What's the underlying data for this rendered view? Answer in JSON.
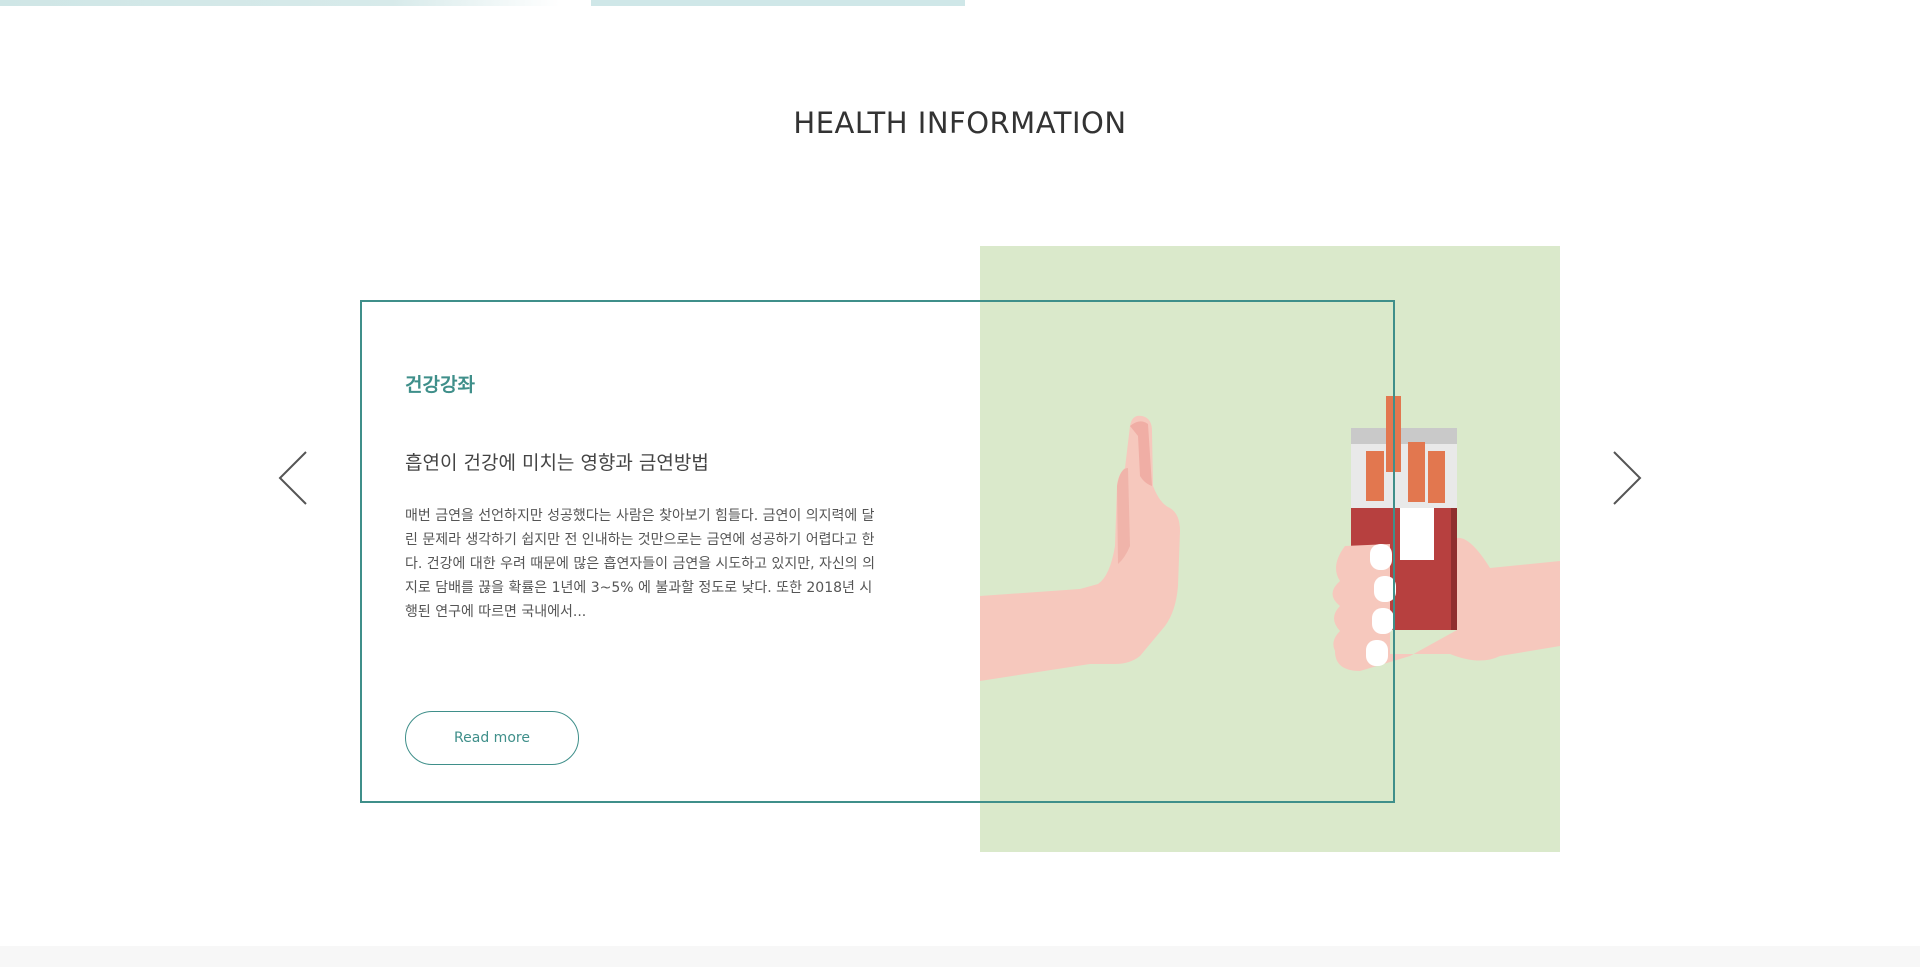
{
  "section": {
    "title": "HEALTH INFORMATION"
  },
  "card": {
    "category": "건강강좌",
    "headline": "흡연이 건강에 미치는 영향과 금연방법",
    "body": "매번 금연을 선언하지만 성공했다는 사람은 찾아보기 힘들다. 금연이 의지력에 달린 문제라 생각하기 쉽지만 전 인내하는 것만으로는 금연에 성공하기 어렵다고 한다. 건강에 대한 우려 때문에 많은 흡연자들이 금연을 시도하고 있지만, 자신의 의지로 담배를 끊을 확률은 1년에 3~5% 에 불과할 정도로 낮다. 또한 2018년 시행된 연구에 따르면 국내에서...",
    "read_more_label": "Read more"
  },
  "navigation": {
    "prev_icon": "chevron-left-icon",
    "next_icon": "chevron-right-icon"
  },
  "colors": {
    "accent": "#3f8f8a",
    "illustration_bg": "#dae9cb",
    "skin": "#f6c8bd",
    "pack_red": "#b7403f",
    "cigarette_orange": "#e2774f"
  }
}
